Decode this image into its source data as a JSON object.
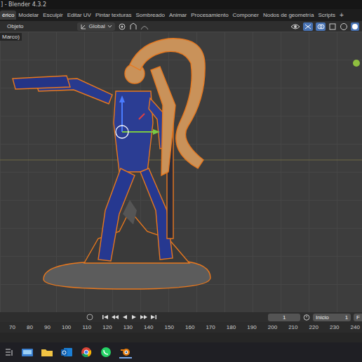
{
  "window": {
    "title": "] - Blender 4.3.2"
  },
  "tabs": [
    {
      "label": "érico",
      "selected": true
    },
    {
      "label": "Modelar",
      "selected": false
    },
    {
      "label": "Esculpir",
      "selected": false
    },
    {
      "label": "Editar UV",
      "selected": false
    },
    {
      "label": "Pintar texturas",
      "selected": false
    },
    {
      "label": "Sombreado",
      "selected": false
    },
    {
      "label": "Animar",
      "selected": false
    },
    {
      "label": "Procesamiento",
      "selected": false
    },
    {
      "label": "Componer",
      "selected": false
    },
    {
      "label": "Nodos de geometría",
      "selected": false
    },
    {
      "label": "Scripts",
      "selected": false
    }
  ],
  "add_tab": "+",
  "header": {
    "mode": "Objeto",
    "orientation": "Global"
  },
  "viewport": {
    "overlay_text": "Marco)"
  },
  "timeline": {
    "current_frame": "1",
    "start_label": "Inicio",
    "start_frame": "1",
    "end_label": "F"
  },
  "ruler": {
    "ticks": [
      "70",
      "80",
      "90",
      "100",
      "110",
      "120",
      "130",
      "140",
      "150",
      "160",
      "170",
      "180",
      "190",
      "200",
      "210",
      "220",
      "230",
      "240"
    ]
  }
}
